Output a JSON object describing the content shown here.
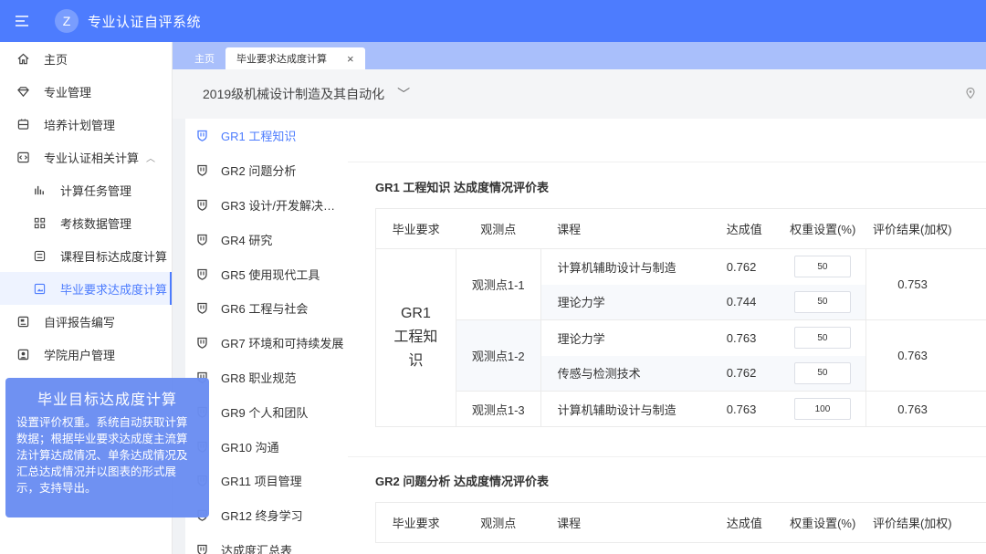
{
  "header": {
    "logo_letter": "Z",
    "app_title": "专业认证自评系统"
  },
  "sidebar": {
    "items": [
      {
        "label": "主页",
        "icon": "home-icon"
      },
      {
        "label": "专业管理",
        "icon": "diamond-icon"
      },
      {
        "label": "培养计划管理",
        "icon": "plan-icon"
      },
      {
        "label": "专业认证相关计算",
        "icon": "code-icon",
        "expanded": true
      },
      {
        "label": "计算任务管理",
        "icon": "bar-chart-icon"
      },
      {
        "label": "考核数据管理",
        "icon": "grid-icon"
      },
      {
        "label": "课程目标达成度计算",
        "icon": "list-icon"
      },
      {
        "label": "毕业要求达成度计算",
        "icon": "image-icon",
        "active": true
      },
      {
        "label": "自评报告编写",
        "icon": "report-icon"
      },
      {
        "label": "学院用户管理",
        "icon": "user-icon"
      }
    ]
  },
  "tooltip": {
    "title": "毕业目标达成度计算",
    "body": "设置评价权重。系统自动获取计算数据；根据毕业要求达成度主流算法计算达成情况、单条达成情况及汇总达成情况并以图表的形式展示，支持导出。"
  },
  "tabs": [
    {
      "label": "主页"
    },
    {
      "label": "毕业要求达成度计算",
      "active": true,
      "close": "×"
    }
  ],
  "major_selector": {
    "value": "2019级机械设计制造及其自动化",
    "chevron": "﹀"
  },
  "location_text": "♀",
  "gr_list": [
    {
      "label": "GR1 工程知识",
      "active": true
    },
    {
      "label": "GR2 问题分析"
    },
    {
      "label": "GR3 设计/开发解决…"
    },
    {
      "label": "GR4 研究"
    },
    {
      "label": "GR5 使用现代工具"
    },
    {
      "label": "GR6 工程与社会"
    },
    {
      "label": "GR7 环境和可持续发展"
    },
    {
      "label": "GR8 职业规范"
    },
    {
      "label": "GR9 个人和团队"
    },
    {
      "label": "GR10 沟通"
    },
    {
      "label": "GR11 项目管理"
    },
    {
      "label": "GR12 终身学习"
    },
    {
      "label": "达成度汇总表"
    }
  ],
  "table_headers": {
    "req": "毕业要求",
    "obs": "观测点",
    "course": "课程",
    "value": "达成值",
    "weight": "权重设置(%)",
    "result": "评价结果(加权)"
  },
  "section1": {
    "title": "GR1 工程知识 达成度情况评价表",
    "req_line1": "GR1",
    "req_line2": "工程知",
    "req_line3": "识",
    "obs1": {
      "label": "观测点1-1",
      "result": "0.753",
      "rows": [
        {
          "course": "计算机辅助设计与制造",
          "value": "0.762",
          "weight": "50"
        },
        {
          "course": "理论力学",
          "value": "0.744",
          "weight": "50"
        }
      ]
    },
    "obs2": {
      "label": "观测点1-2",
      "result": "0.763",
      "rows": [
        {
          "course": "理论力学",
          "value": "0.763",
          "weight": "50"
        },
        {
          "course": "传感与检测技术",
          "value": "0.762",
          "weight": "50"
        }
      ]
    },
    "obs3": {
      "label": "观测点1-3",
      "result": "0.763",
      "rows": [
        {
          "course": "计算机辅助设计与制造",
          "value": "0.763",
          "weight": "100"
        }
      ]
    }
  },
  "section2": {
    "title": "GR2 问题分析 达成度情况评价表"
  },
  "colors": {
    "primary": "#4d7cfe",
    "tab_bar": "#a9bffb",
    "tooltip": "#6b8ef2"
  }
}
